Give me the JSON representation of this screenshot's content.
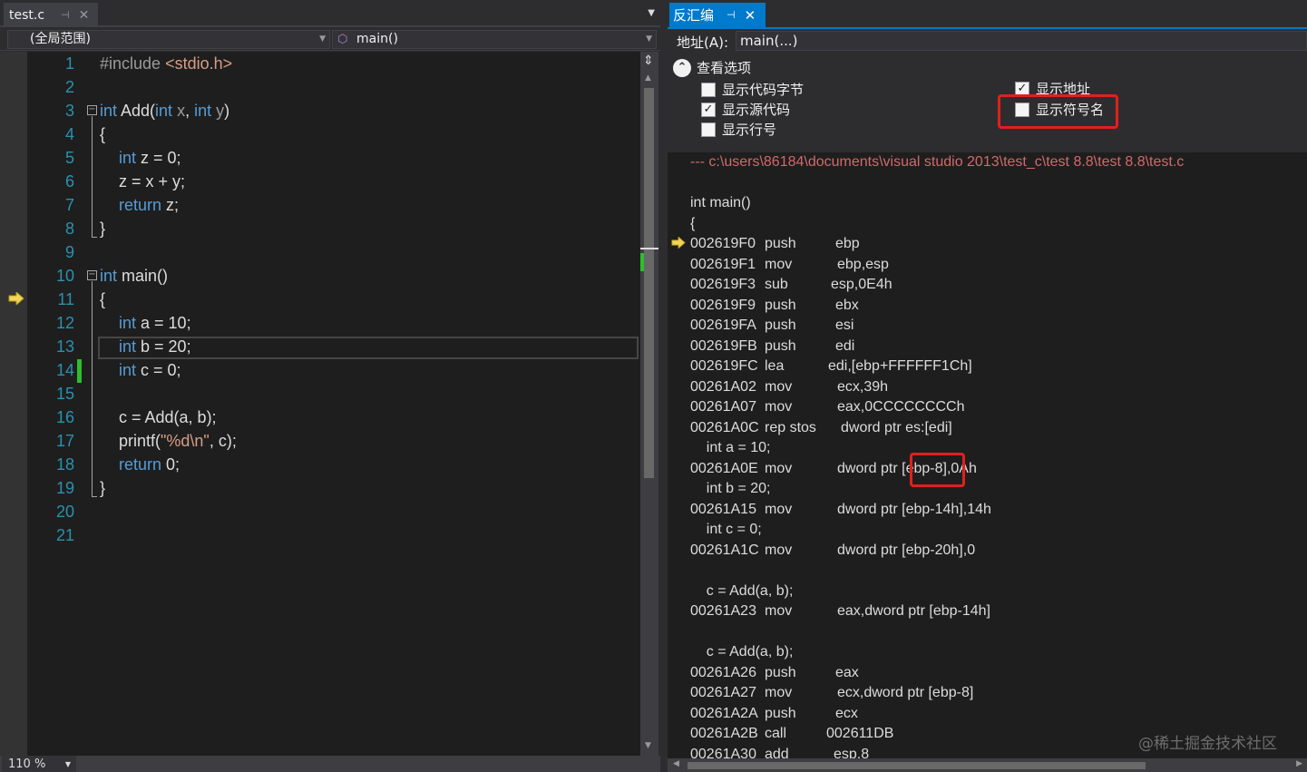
{
  "editor": {
    "tab_title": "test.c",
    "pin_glyph": "⊣",
    "close_glyph": "✕",
    "scope": "(全局范围)",
    "function": "main()",
    "zoom": "110 %",
    "line_numbers": [
      "1",
      "2",
      "3",
      "4",
      "5",
      "6",
      "7",
      "8",
      "9",
      "10",
      "11",
      "12",
      "13",
      "14",
      "15",
      "16",
      "17",
      "18",
      "19",
      "20",
      "21"
    ],
    "code": {
      "l1_pp": "#include ",
      "l1_hdr": "<stdio.h>",
      "l3_kw": "int",
      "l3_name": " Add(",
      "l3_kw2": "int",
      "l3_p1": " x",
      "l3_c": ", ",
      "l3_kw3": "int",
      "l3_p2": " y",
      "l3_end": ")",
      "l4": "{",
      "l5_kw": "int",
      "l5_rest": " z = 0;",
      "l6": "z = x + y;",
      "l7_kw": "return",
      "l7_rest": " z;",
      "l8": "}",
      "l10_kw": "int",
      "l10_rest": " main()",
      "l11": "{",
      "l12_kw": "int",
      "l12_rest": " a = 10;",
      "l13_kw": "int",
      "l13_rest": " b = 20;",
      "l14_kw": "int",
      "l14_rest": " c = 0;",
      "l16": "c = Add(a, b);",
      "l17_a": "printf(",
      "l17_str": "\"%d\\n\"",
      "l17_b": ", c);",
      "l18_kw": "return",
      "l18_rest": " 0;",
      "l19": "}"
    }
  },
  "disasm": {
    "tab_title": "反汇编",
    "address_label": "地址(A):",
    "address_value": "main(...)",
    "options_title": "查看选项",
    "options": {
      "show_code_bytes": "显示代码字节",
      "show_source": "显示源代码",
      "show_line_numbers": "显示行号",
      "show_address": "显示地址",
      "show_symbol_names": "显示符号名"
    },
    "checked": {
      "show_code_bytes": false,
      "show_source": true,
      "show_line_numbers": false,
      "show_address": true,
      "show_symbol_names": false
    },
    "path": "--- c:\\users\\86184\\documents\\visual studio 2013\\test_c\\test 8.8\\test 8.8\\test.c",
    "lines": [
      {
        "src": "int main()"
      },
      {
        "src": "{"
      },
      {
        "addr": "002619F0",
        "mn": "push",
        "op": "ebp"
      },
      {
        "addr": "002619F1",
        "mn": "mov",
        "op": "ebp,esp"
      },
      {
        "addr": "002619F3",
        "mn": "sub",
        "op": "esp,0E4h"
      },
      {
        "addr": "002619F9",
        "mn": "push",
        "op": "ebx"
      },
      {
        "addr": "002619FA",
        "mn": "push",
        "op": "esi"
      },
      {
        "addr": "002619FB",
        "mn": "push",
        "op": "edi"
      },
      {
        "addr": "002619FC",
        "mn": "lea",
        "op": "edi,[ebp+FFFFFF1Ch]"
      },
      {
        "addr": "00261A02",
        "mn": "mov",
        "op": "ecx,39h"
      },
      {
        "addr": "00261A07",
        "mn": "mov",
        "op": "eax,0CCCCCCCCh"
      },
      {
        "addr": "00261A0C",
        "mn": "rep stos",
        "op": "dword ptr es:[edi]"
      },
      {
        "src": "    int a = 10;"
      },
      {
        "addr": "00261A0E",
        "mn": "mov",
        "op": "dword ptr [ebp-8],0Ah"
      },
      {
        "src": "    int b = 20;"
      },
      {
        "addr": "00261A15",
        "mn": "mov",
        "op": "dword ptr [ebp-14h],14h"
      },
      {
        "src": "    int c = 0;"
      },
      {
        "addr": "00261A1C",
        "mn": "mov",
        "op": "dword ptr [ebp-20h],0"
      },
      {
        "src": ""
      },
      {
        "src": "    c = Add(a, b);"
      },
      {
        "addr": "00261A23",
        "mn": "mov",
        "op": "eax,dword ptr [ebp-14h]"
      },
      {
        "src": ""
      },
      {
        "src": "    c = Add(a, b);"
      },
      {
        "addr": "00261A26",
        "mn": "push",
        "op": "eax"
      },
      {
        "addr": "00261A27",
        "mn": "mov",
        "op": "ecx,dword ptr [ebp-8]"
      },
      {
        "addr": "00261A2A",
        "mn": "push",
        "op": "ecx"
      },
      {
        "addr": "00261A2B",
        "mn": "call",
        "op": "002611DB"
      },
      {
        "addr": "00261A30",
        "mn": "add",
        "op": "esp,8"
      }
    ]
  },
  "watermark": "@稀土掘金技术社区",
  "colors": {
    "accent": "#007acc",
    "keyword": "#569cd6",
    "line_number": "#2b91af",
    "highlight_box": "#e0211b",
    "change_bar": "#2dbe2d",
    "path": "#d16969"
  }
}
